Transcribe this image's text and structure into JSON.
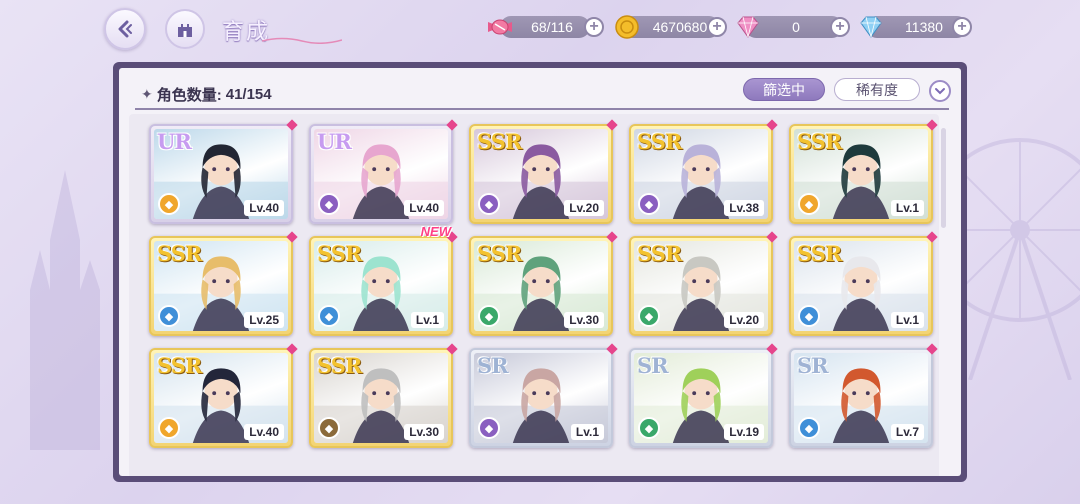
{
  "header": {
    "title": "育成"
  },
  "resources": [
    {
      "name": "candy",
      "icon": "candy-icon",
      "value": "68/116",
      "color": "#e85a8c"
    },
    {
      "name": "gold",
      "icon": "coin-icon",
      "value": "4670680",
      "color": "#f0b21b"
    },
    {
      "name": "pink-diamond",
      "icon": "pink-diamond-icon",
      "value": "0",
      "color": "#e57ab8"
    },
    {
      "name": "blue-diamond",
      "icon": "blue-diamond-icon",
      "value": "11380",
      "color": "#6fb3e8"
    }
  ],
  "panel": {
    "count_label": "角色数量:",
    "count_value": "41/154",
    "filter_label": "篩选中",
    "rarity_label": "稀有度"
  },
  "cards": [
    {
      "rarity": "UR",
      "level": "Lv.40",
      "element": "orange",
      "hair": "#222633",
      "bg": "#bcd8ea",
      "new": false
    },
    {
      "rarity": "UR",
      "level": "Lv.40",
      "element": "purple",
      "hair": "#e7a6cf",
      "bg": "#efd6e6",
      "new": false
    },
    {
      "rarity": "SSR",
      "level": "Lv.20",
      "element": "purple",
      "hair": "#8a5aa0",
      "bg": "#d6c7da",
      "new": false
    },
    {
      "rarity": "SSR",
      "level": "Lv.38",
      "element": "purple",
      "hair": "#b9b2d9",
      "bg": "#cfd6e3",
      "new": false
    },
    {
      "rarity": "SSR",
      "level": "Lv.1",
      "element": "orange",
      "hair": "#1e3a3c",
      "bg": "#d2e0d6",
      "new": false
    },
    {
      "rarity": "SSR",
      "level": "Lv.25",
      "element": "blue",
      "hair": "#e7bd6a",
      "bg": "#cfe4f1",
      "new": false
    },
    {
      "rarity": "SSR",
      "level": "Lv.1",
      "element": "blue",
      "hair": "#9ce3cf",
      "bg": "#d7ecea",
      "new": true
    },
    {
      "rarity": "SSR",
      "level": "Lv.30",
      "element": "green",
      "hair": "#5fa27c",
      "bg": "#d8e9d6",
      "new": false
    },
    {
      "rarity": "SSR",
      "level": "Lv.20",
      "element": "green",
      "hair": "#c8c8c2",
      "bg": "#e4e6df",
      "new": false
    },
    {
      "rarity": "SSR",
      "level": "Lv.1",
      "element": "blue",
      "hair": "#e8e8ec",
      "bg": "#dbe3ec",
      "new": false
    },
    {
      "rarity": "SSR",
      "level": "Lv.40",
      "element": "orange",
      "hair": "#23263a",
      "bg": "#d4e3ee",
      "new": false
    },
    {
      "rarity": "SSR",
      "level": "Lv.30",
      "element": "brown",
      "hair": "#bfbfbf",
      "bg": "#d8d4cf",
      "new": false
    },
    {
      "rarity": "SR",
      "level": "Lv.1",
      "element": "purple",
      "hair": "#c9a6a3",
      "bg": "#c7c9d9",
      "new": false
    },
    {
      "rarity": "SR",
      "level": "Lv.19",
      "element": "green",
      "hair": "#9fd05a",
      "bg": "#e3ecd8",
      "new": false
    },
    {
      "rarity": "SR",
      "level": "Lv.7",
      "element": "blue",
      "hair": "#d2582e",
      "bg": "#d6e4f0",
      "new": false
    }
  ],
  "new_label": "NEW"
}
